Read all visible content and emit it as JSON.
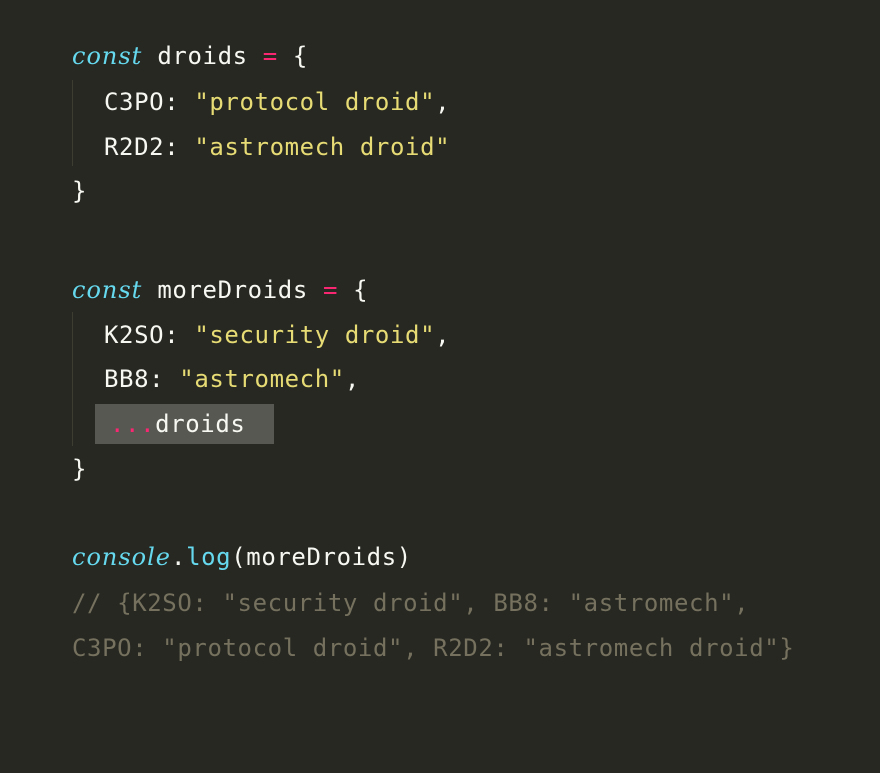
{
  "code": {
    "block1": {
      "keyword": "const",
      "name": "droids",
      "op": "=",
      "open": "{",
      "props": [
        {
          "key": "C3PO",
          "colon": ":",
          "value": "\"protocol droid\"",
          "comma": ","
        },
        {
          "key": "R2D2",
          "colon": ":",
          "value": "\"astromech droid\"",
          "comma": ""
        }
      ],
      "close": "}"
    },
    "block2": {
      "keyword": "const",
      "name": "moreDroids",
      "op": "=",
      "open": "{",
      "props": [
        {
          "key": "K2SO",
          "colon": ":",
          "value": "\"security droid\"",
          "comma": ","
        },
        {
          "key": "BB8",
          "colon": ":",
          "value": "\"astromech\"",
          "comma": ","
        }
      ],
      "spread": {
        "dots": "...",
        "target": "droids"
      },
      "close": "}"
    },
    "log": {
      "object": "console",
      "dot": ".",
      "method": "log",
      "open_paren": "(",
      "arg": "moreDroids",
      "close_paren": ")"
    },
    "comment": {
      "line1": "// {K2SO: \"security droid\", BB8: \"astromech\",",
      "line2": "C3PO: \"protocol droid\", R2D2: \"astromech droid\"}"
    }
  },
  "colors": {
    "background": "#272822",
    "keyword": "#66d9ef",
    "operator": "#f92672",
    "string": "#e6db74",
    "comment": "#75715e",
    "highlight": "#575851"
  }
}
